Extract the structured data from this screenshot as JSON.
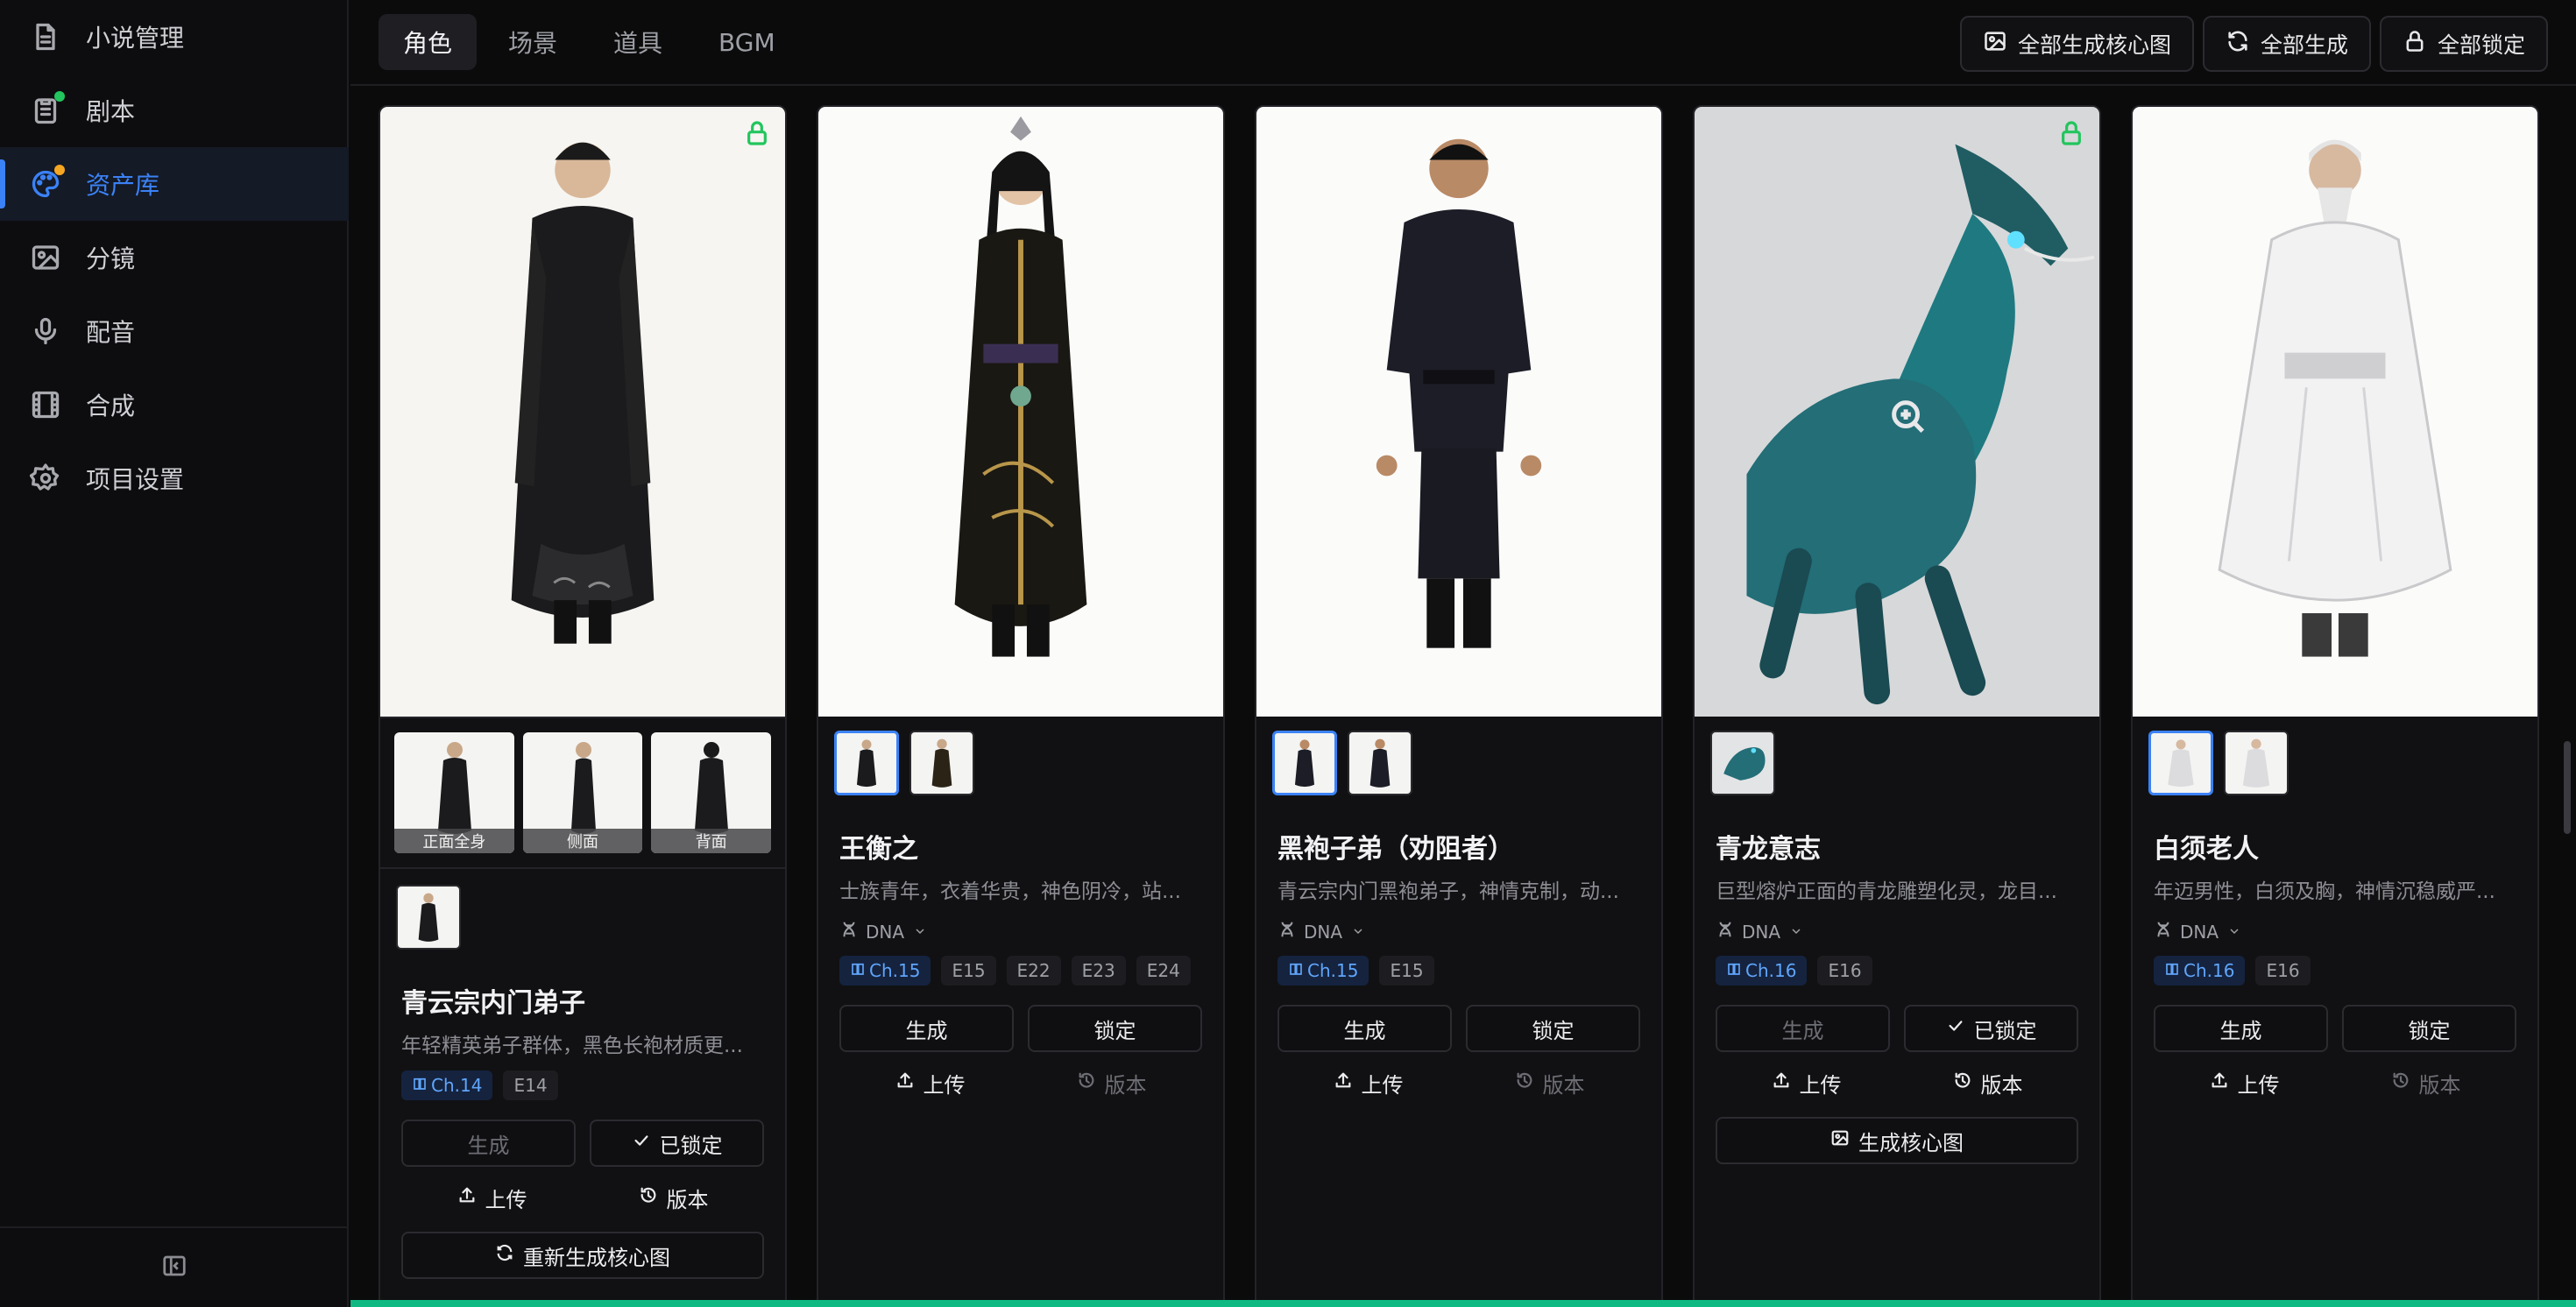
{
  "sidebar": {
    "items": [
      {
        "label": "小说管理",
        "icon": "document-icon"
      },
      {
        "label": "剧本",
        "icon": "clipboard-icon",
        "dot": "#22c55e"
      },
      {
        "label": "资产库",
        "icon": "palette-icon",
        "dot": "#f5a623",
        "active": true
      },
      {
        "label": "分镜",
        "icon": "image-icon"
      },
      {
        "label": "配音",
        "icon": "microphone-icon"
      },
      {
        "label": "合成",
        "icon": "film-icon"
      },
      {
        "label": "项目设置",
        "icon": "gear-icon"
      }
    ],
    "collapse_icon": "sidebar-collapse-icon"
  },
  "tabs": [
    "角色",
    "场景",
    "道具",
    "BGM"
  ],
  "active_tab": "角色",
  "top_actions": {
    "generate_all_core": "全部生成核心图",
    "generate_all": "全部生成",
    "lock_all": "全部锁定"
  },
  "labels": {
    "generate": "生成",
    "lock": "锁定",
    "locked": "已锁定",
    "upload": "上传",
    "version": "版本",
    "dna": "DNA",
    "regen_core": "重新生成核心图",
    "gen_core": "生成核心图"
  },
  "views": [
    "正面全身",
    "侧面",
    "背面"
  ],
  "cards": [
    {
      "name": "青云宗内门弟子",
      "desc": "年轻精英弟子群体，黑色长袍材质更...",
      "chapter": "Ch.14",
      "episodes": [
        "E14"
      ],
      "locked": true
    },
    {
      "name": "王衡之",
      "desc": "士族青年，衣着华贵，神色阴冷，站...",
      "chapter": "Ch.15",
      "episodes": [
        "E15",
        "E22",
        "E23",
        "E24"
      ],
      "locked": false
    },
    {
      "name": "黑袍子弟（劝阻者）",
      "desc": "青云宗内门黑袍弟子，神情克制，动...",
      "chapter": "Ch.15",
      "episodes": [
        "E15"
      ],
      "locked": false
    },
    {
      "name": "青龙意志",
      "desc": "巨型熔炉正面的青龙雕塑化灵，龙目...",
      "chapter": "Ch.16",
      "episodes": [
        "E16"
      ],
      "locked": true
    },
    {
      "name": "白须老人",
      "desc": "年迈男性，白须及胸，神情沉稳威严...",
      "chapter": "Ch.16",
      "episodes": [
        "E16"
      ],
      "locked": false
    }
  ],
  "colors": {
    "accent": "#3b82f6",
    "lock": "#22c55e",
    "progress": "#10b981"
  }
}
